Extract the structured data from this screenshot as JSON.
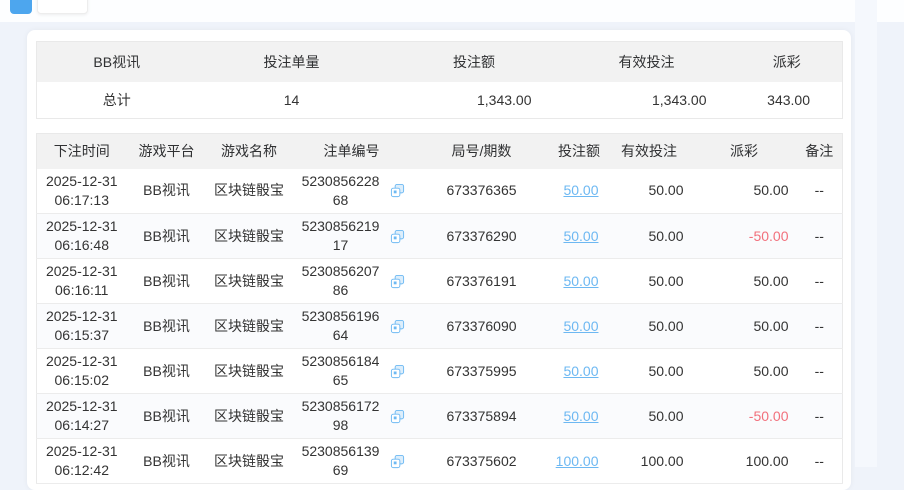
{
  "colors": {
    "accent": "#4da6ee",
    "link": "#6db8f2",
    "negative": "#f2707c",
    "header_bg": "#f2f2f2"
  },
  "summary": {
    "headers": [
      "BB视讯",
      "投注单量",
      "投注额",
      "有效投注",
      "派彩"
    ],
    "totals": {
      "label": "总计",
      "count": "14",
      "bet": "1,343.00",
      "valid": "1,343.00",
      "payout": "343.00"
    }
  },
  "bets": {
    "headers": [
      "下注时间",
      "游戏平台",
      "游戏名称",
      "注单编号",
      "局号/期数",
      "投注额",
      "有效投注",
      "派彩",
      "备注"
    ],
    "rows": [
      {
        "time": "2025-12-31 06:17:13",
        "platform": "BB视讯",
        "game": "区块链骰宝",
        "bet_no": "523085622868",
        "round": "673376365",
        "bet": "50.00",
        "valid": "50.00",
        "payout": "50.00",
        "remark": "--"
      },
      {
        "time": "2025-12-31 06:16:48",
        "platform": "BB视讯",
        "game": "区块链骰宝",
        "bet_no": "523085621917",
        "round": "673376290",
        "bet": "50.00",
        "valid": "50.00",
        "payout": "-50.00",
        "remark": "--"
      },
      {
        "time": "2025-12-31 06:16:11",
        "platform": "BB视讯",
        "game": "区块链骰宝",
        "bet_no": "523085620786",
        "round": "673376191",
        "bet": "50.00",
        "valid": "50.00",
        "payout": "50.00",
        "remark": "--"
      },
      {
        "time": "2025-12-31 06:15:37",
        "platform": "BB视讯",
        "game": "区块链骰宝",
        "bet_no": "523085619664",
        "round": "673376090",
        "bet": "50.00",
        "valid": "50.00",
        "payout": "50.00",
        "remark": "--"
      },
      {
        "time": "2025-12-31 06:15:02",
        "platform": "BB视讯",
        "game": "区块链骰宝",
        "bet_no": "523085618465",
        "round": "673375995",
        "bet": "50.00",
        "valid": "50.00",
        "payout": "50.00",
        "remark": "--"
      },
      {
        "time": "2025-12-31 06:14:27",
        "platform": "BB视讯",
        "game": "区块链骰宝",
        "bet_no": "523085617298",
        "round": "673375894",
        "bet": "50.00",
        "valid": "50.00",
        "payout": "-50.00",
        "remark": "--"
      },
      {
        "time": "2025-12-31 06:12:42",
        "platform": "BB视讯",
        "game": "区块链骰宝",
        "bet_no": "523085613969",
        "round": "673375602",
        "bet": "100.00",
        "valid": "100.00",
        "payout": "100.00",
        "remark": "--"
      }
    ]
  }
}
